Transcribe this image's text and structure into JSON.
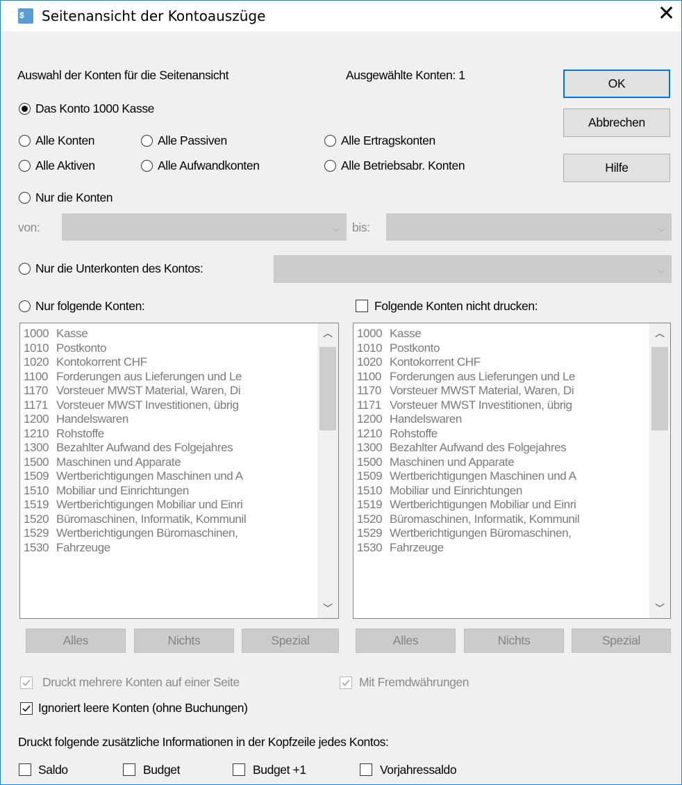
{
  "window": {
    "title": "Seitenansicht der Kontoauszüge"
  },
  "selection": {
    "heading": "Auswahl der Konten für die Seitenansicht",
    "selected_count_label": "Ausgewählte Konten: 1",
    "radio_this_account": "Das Konto  1000  Kasse",
    "radio_all_accounts": "Alle Konten",
    "radio_all_liabilities": "Alle Passiven",
    "radio_all_income": "Alle Ertragskonten",
    "radio_all_assets": "Alle Aktiven",
    "radio_all_expense": "Alle Aufwandkonten",
    "radio_all_operating": "Alle Betriebsabr. Konten",
    "radio_only_accounts": "Nur die Konten",
    "from_label": "von:",
    "to_label": "bis:",
    "radio_subaccounts": "Nur die Unterkonten des Kontos:",
    "radio_following": "Nur folgende Konten:",
    "check_dont_print": "Folgende Konten nicht drucken:"
  },
  "buttons": {
    "ok": "OK",
    "cancel": "Abbrechen",
    "help": "Hilfe"
  },
  "list_buttons": {
    "all": "Alles",
    "none": "Nichts",
    "special": "Spezial"
  },
  "accounts": [
    {
      "num": "1000",
      "name": "Kasse"
    },
    {
      "num": "1010",
      "name": "Postkonto"
    },
    {
      "num": "1020",
      "name": "Kontokorrent CHF"
    },
    {
      "num": "1100",
      "name": "Forderungen aus Lieferungen und Le"
    },
    {
      "num": "1170",
      "name": "Vorsteuer MWST Material, Waren, Di"
    },
    {
      "num": "1171",
      "name": "Vorsteuer MWST Investitionen, übrig"
    },
    {
      "num": "1200",
      "name": "Handelswaren"
    },
    {
      "num": "1210",
      "name": "Rohstoffe"
    },
    {
      "num": "1300",
      "name": "Bezahlter Aufwand des Folgejahres"
    },
    {
      "num": "1500",
      "name": "Maschinen und Apparate"
    },
    {
      "num": "1509",
      "name": "Wertberichtigungen Maschinen und A"
    },
    {
      "num": "1510",
      "name": "Mobiliar und Einrichtungen"
    },
    {
      "num": "1519",
      "name": "Wertberichtigungen Mobiliar und Einri"
    },
    {
      "num": "1520",
      "name": "Büromaschinen, Informatik, Kommunil"
    },
    {
      "num": "1529",
      "name": "Wertberichtigungen Büromaschinen,"
    },
    {
      "num": "1530",
      "name": "Fahrzeuge"
    }
  ],
  "options": {
    "multi_per_page": "Druckt mehrere Konten auf einer Seite",
    "foreign_currency": "Mit Fremdwährungen",
    "ignore_empty": "Ignoriert leere Konten (ohne Buchungen)"
  },
  "header_info": {
    "heading": "Druckt folgende zusätzliche Informationen in der Kopfzeile jedes Kontos:",
    "saldo": "Saldo",
    "budget": "Budget",
    "budget_plus1": "Budget +1",
    "prior_year": "Vorjahressaldo"
  }
}
